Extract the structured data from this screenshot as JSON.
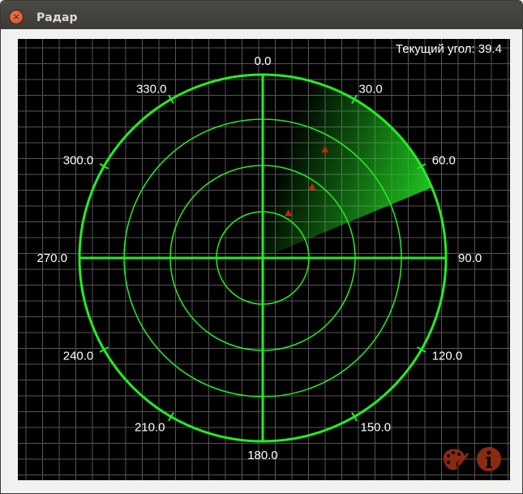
{
  "window": {
    "title": "Радар",
    "close_icon": "close-icon"
  },
  "radar": {
    "current_angle_label": "Текущий угол:",
    "current_angle": 39.4,
    "angle_labels": [
      "0.0",
      "30.0",
      "60.0",
      "90.0",
      "120.0",
      "150.0",
      "180.0",
      "210.0",
      "240.0",
      "270.0",
      "300.0",
      "330.0"
    ],
    "targets": [
      {
        "angle": 30,
        "range": 0.28
      },
      {
        "angle": 35,
        "range": 0.47
      },
      {
        "angle": 30,
        "range": 0.68
      }
    ],
    "colors": {
      "ring": "#22ee22",
      "sweep": "#22cc22",
      "target": "#cc2200",
      "grid": "#555555",
      "background": "#000000"
    }
  },
  "toolbar": {
    "palette_icon": "palette-icon",
    "info_icon": "info-icon"
  }
}
